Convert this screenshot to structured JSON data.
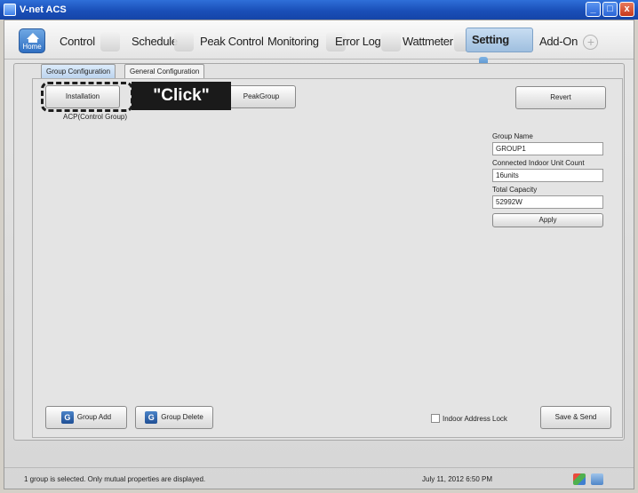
{
  "window": {
    "title": "V-net ACS",
    "min_label": "_",
    "max_label": "□",
    "close_label": "x"
  },
  "nav": {
    "home_label": "Home",
    "tabs": [
      {
        "label": "Control"
      },
      {
        "label": "Schedule"
      },
      {
        "label": "Peak Control"
      },
      {
        "label": "Monitoring"
      },
      {
        "label": "Error Log"
      },
      {
        "label": "Wattmeter"
      },
      {
        "label": "Setting"
      },
      {
        "label": "Add-On"
      }
    ],
    "active_tab": "Setting"
  },
  "subtabs": [
    {
      "label": "Group Configuration",
      "active": true
    },
    {
      "label": "General Configuration",
      "active": false
    }
  ],
  "top_buttons": {
    "installation": "Installation",
    "peak_group": "PeakGroup",
    "revert": "Revert"
  },
  "callout": {
    "text": "\"Click\""
  },
  "group_label": "ACP(Control Group)",
  "properties": {
    "group_name_label": "Group Name",
    "group_name_value": "GROUP1",
    "unit_count_label": "Connected Indoor Unit Count",
    "unit_count_value": "16units",
    "capacity_label": "Total Capacity",
    "capacity_value": "52992W",
    "apply_label": "Apply"
  },
  "bottom": {
    "group_add": "Group Add",
    "group_delete": "Group Delete",
    "g_glyph": "G",
    "indoor_lock_label": "Indoor Address Lock",
    "indoor_lock_checked": false,
    "save_send": "Save & Send"
  },
  "status": {
    "message": "1 group is selected. Only mutual properties are displayed.",
    "datetime": "July 11, 2012  6:50 PM"
  },
  "colors": {
    "accent": "#2f6fd8",
    "active_tab": "#9fbfdf",
    "callout": "#1a1a1a"
  }
}
